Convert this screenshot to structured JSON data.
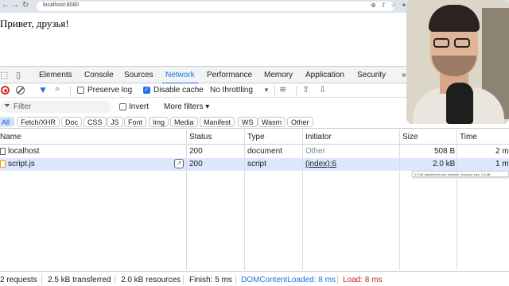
{
  "browser": {
    "url": "localhost:8080"
  },
  "page": {
    "heading": "Привет, друзья!"
  },
  "devtools": {
    "tabs": [
      {
        "label": "Elements",
        "active": false
      },
      {
        "label": "Console",
        "active": false
      },
      {
        "label": "Sources",
        "active": false
      },
      {
        "label": "Network",
        "active": true
      },
      {
        "label": "Performance",
        "active": false
      },
      {
        "label": "Memory",
        "active": false
      },
      {
        "label": "Application",
        "active": false
      },
      {
        "label": "Security",
        "active": false
      }
    ],
    "toolbar": {
      "preserve_log_label": "Preserve log",
      "preserve_log_checked": false,
      "disable_cache_label": "Disable cache",
      "disable_cache_checked": true,
      "throttling_value": "No throttling"
    },
    "filter": {
      "placeholder": "Filter",
      "invert_label": "Invert",
      "more_filters_label": "More filters"
    },
    "type_filters": [
      {
        "label": "All",
        "active": true
      },
      {
        "label": "Fetch/XHR",
        "active": false
      },
      {
        "label": "Doc",
        "active": false
      },
      {
        "label": "CSS",
        "active": false
      },
      {
        "label": "JS",
        "active": false
      },
      {
        "label": "Font",
        "active": false
      },
      {
        "label": "Img",
        "active": false
      },
      {
        "label": "Media",
        "active": false
      },
      {
        "label": "Manifest",
        "active": false
      },
      {
        "label": "WS",
        "active": false
      },
      {
        "label": "Wasm",
        "active": false
      },
      {
        "label": "Other",
        "active": false
      }
    ],
    "table": {
      "columns": [
        "Name",
        "Status",
        "Type",
        "Initiator",
        "Size",
        "Time"
      ],
      "rows": [
        {
          "name": "localhost",
          "status": "200",
          "type": "document",
          "initiator": "Other",
          "size": "508 B",
          "time": "2 m"
        },
        {
          "name": "script.js",
          "status": "200",
          "type": "script",
          "initiator": "(index):6",
          "size": "2.0 kB",
          "time": "1 m"
        }
      ],
      "size_tooltip": "2.0 kB transferred over network, resource size: 1.8 kB"
    },
    "status": {
      "requests": "2 requests",
      "transferred": "2.5 kB transferred",
      "resources": "2.0 kB resources",
      "finish": "Finish: 5 ms",
      "dom_content_loaded": "DOMContentLoaded: 8 ms",
      "load": "Load: 8 ms"
    }
  },
  "colors": {
    "accent": "#1a73e8",
    "dcl": "#1a73e8",
    "load": "#c5221f",
    "selected_row": "#dbe7fb"
  }
}
